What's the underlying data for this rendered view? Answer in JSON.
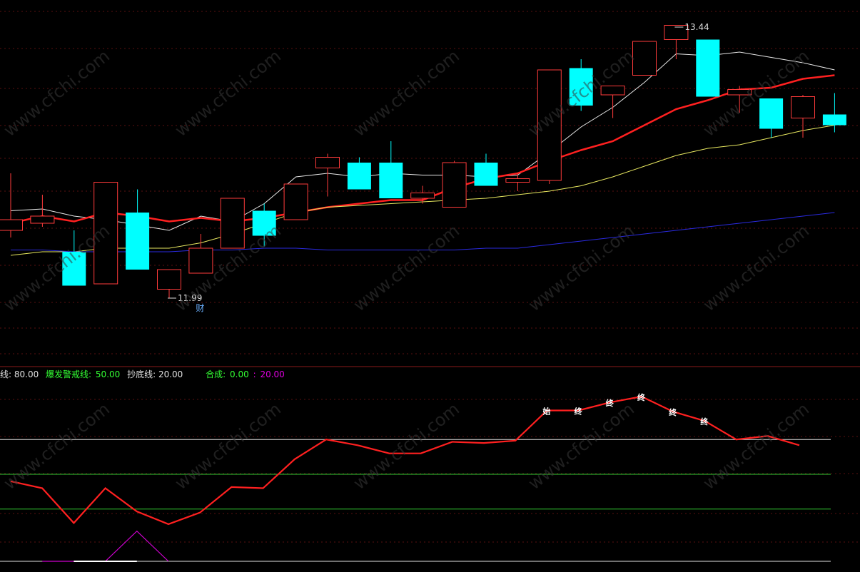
{
  "chart_data": [
    {
      "type": "candlestick",
      "price_range": [
        11.6,
        13.56
      ],
      "labels": {
        "high": "13.44",
        "low": "11.99",
        "marker": "财"
      },
      "up_color": "#ff3b3b",
      "down_color": "#00ffff",
      "candles": [
        {
          "open": 12.3,
          "close": 12.36,
          "high": 12.62,
          "low": 12.26
        },
        {
          "open": 12.34,
          "close": 12.38,
          "high": 12.5,
          "low": 12.32
        },
        {
          "open": 12.18,
          "close": 11.99,
          "high": 12.3,
          "low": 11.99
        },
        {
          "open": 12.0,
          "close": 12.57,
          "high": 12.57,
          "low": 12.0
        },
        {
          "open": 12.4,
          "close": 12.08,
          "high": 12.53,
          "low": 12.08
        },
        {
          "open": 11.97,
          "close": 12.08,
          "high": 12.08,
          "low": 11.92
        },
        {
          "open": 12.06,
          "close": 12.2,
          "high": 12.28,
          "low": 12.06
        },
        {
          "open": 12.2,
          "close": 12.48,
          "high": 12.48,
          "low": 12.2
        },
        {
          "open": 12.41,
          "close": 12.27,
          "high": 12.45,
          "low": 12.21
        },
        {
          "open": 12.36,
          "close": 12.56,
          "high": 12.56,
          "low": 12.36
        },
        {
          "open": 12.65,
          "close": 12.71,
          "high": 12.73,
          "low": 12.49
        },
        {
          "open": 12.68,
          "close": 12.53,
          "high": 12.71,
          "low": 12.53
        },
        {
          "open": 12.68,
          "close": 12.48,
          "high": 12.8,
          "low": 12.48
        },
        {
          "open": 12.48,
          "close": 12.51,
          "high": 12.55,
          "low": 12.45
        },
        {
          "open": 12.43,
          "close": 12.68,
          "high": 12.69,
          "low": 12.43
        },
        {
          "open": 12.68,
          "close": 12.55,
          "high": 12.73,
          "low": 12.55
        },
        {
          "open": 12.57,
          "close": 12.59,
          "high": 12.62,
          "low": 12.52
        },
        {
          "open": 12.58,
          "close": 13.2,
          "high": 13.2,
          "low": 12.56
        },
        {
          "open": 13.21,
          "close": 13.0,
          "high": 13.26,
          "low": 12.97
        },
        {
          "open": 13.06,
          "close": 13.11,
          "high": 13.11,
          "low": 12.93
        },
        {
          "open": 13.17,
          "close": 13.36,
          "high": 13.36,
          "low": 13.24
        },
        {
          "open": 13.37,
          "close": 13.45,
          "high": 13.44,
          "low": 13.26
        },
        {
          "open": 13.37,
          "close": 13.05,
          "high": 13.37,
          "low": 13.05
        },
        {
          "open": 13.06,
          "close": 13.09,
          "high": 13.11,
          "low": 12.96
        },
        {
          "open": 13.04,
          "close": 12.87,
          "high": 13.04,
          "low": 12.82
        },
        {
          "open": 12.93,
          "close": 13.05,
          "high": 13.06,
          "low": 12.82
        },
        {
          "open": 12.95,
          "close": 12.89,
          "high": 13.07,
          "low": 12.85
        }
      ],
      "ma_lines": [
        {
          "color": "#e8e8e8",
          "width": 1,
          "values": [
            12.41,
            12.42,
            12.38,
            12.36,
            12.33,
            12.3,
            12.38,
            12.35,
            12.45,
            12.6,
            12.62,
            12.6,
            12.62,
            12.61,
            12.61,
            12.6,
            12.61,
            12.74,
            12.88,
            12.99,
            13.13,
            13.29,
            13.28,
            13.3,
            13.27,
            13.24,
            13.2
          ]
        },
        {
          "color": "#ff2020",
          "width": 2.5,
          "values": [
            12.34,
            12.38,
            12.35,
            12.4,
            12.38,
            12.35,
            12.37,
            12.35,
            12.37,
            12.4,
            12.43,
            12.45,
            12.47,
            12.47,
            12.54,
            12.59,
            12.62,
            12.69,
            12.75,
            12.8,
            12.89,
            12.98,
            13.03,
            13.09,
            13.1,
            13.15,
            13.17
          ]
        },
        {
          "color": "#e8e860",
          "width": 1,
          "values": [
            12.16,
            12.18,
            12.18,
            12.2,
            12.2,
            12.2,
            12.23,
            12.28,
            12.34,
            12.4,
            12.43,
            12.44,
            12.45,
            12.46,
            12.47,
            12.48,
            12.5,
            12.52,
            12.55,
            12.6,
            12.66,
            12.72,
            12.76,
            12.78,
            12.82,
            12.86,
            12.89
          ]
        },
        {
          "color": "#2a2ae0",
          "width": 1,
          "values": [
            12.19,
            12.19,
            12.18,
            12.18,
            12.18,
            12.18,
            12.19,
            12.19,
            12.2,
            12.2,
            12.19,
            12.19,
            12.19,
            12.19,
            12.19,
            12.2,
            12.2,
            12.22,
            12.24,
            12.26,
            12.28,
            12.3,
            12.32,
            12.34,
            12.36,
            12.38,
            12.4
          ]
        }
      ]
    },
    {
      "type": "line",
      "y_range": [
        -25,
        133
      ],
      "legend": [
        {
          "text": "线: 80.00",
          "color": "#e0e0e0"
        },
        {
          "text": "爆发警戒线:",
          "color": "#33ff33"
        },
        {
          "text": "50.00",
          "color": "#33ff33"
        },
        {
          "text": "抄底线: 20.00",
          "color": "#e0e0e0"
        },
        {
          "text": "合成:",
          "color": "#33ff33"
        },
        {
          "text": "0.00",
          "color": "#33ff33"
        },
        {
          "text": ":",
          "color": "#e000e0"
        },
        {
          "text": "20.00",
          "color": "#e000e0"
        }
      ],
      "levels": [
        {
          "value": 80,
          "color": "#e0e0e0"
        },
        {
          "value": 50,
          "color": "#33cc33"
        },
        {
          "value": 20,
          "color": "#33cc33"
        },
        {
          "value": -25,
          "color": "#e0e0e0"
        }
      ],
      "series": [
        {
          "color": "#ff2020",
          "values": [
            44,
            38,
            8,
            38,
            18,
            7,
            17,
            39,
            38,
            63,
            80,
            75,
            68,
            68,
            78,
            77,
            79,
            105,
            105,
            112,
            117,
            104,
            96,
            80,
            83,
            75
          ]
        },
        {
          "color": "#cc00cc",
          "values": [
            -25,
            -25,
            -25,
            1,
            -25
          ]
        }
      ],
      "annotations": [
        {
          "index": 17,
          "text": "始"
        },
        {
          "index": 18,
          "text": "终"
        },
        {
          "index": 19,
          "text": "终"
        },
        {
          "index": 20,
          "text": "终"
        },
        {
          "index": 21,
          "text": "终"
        },
        {
          "index": 22,
          "text": "终"
        }
      ]
    }
  ],
  "watermark": "www.cfchi.com"
}
